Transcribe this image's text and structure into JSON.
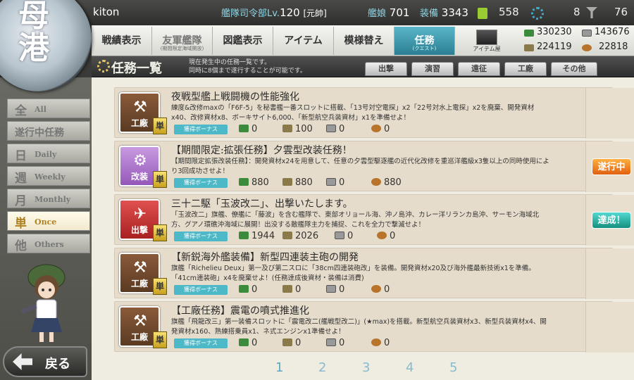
{
  "header": {
    "player": "kiton",
    "hq_label": "艦隊司令部Lv.",
    "hq_level": "120",
    "rank": "[元帥]",
    "ships_label": "艦娘",
    "ships": "701",
    "equip_label": "装備",
    "equip": "3343",
    "bucket": "558",
    "dev_mat": "8",
    "screw": "76"
  },
  "logo_text": "母港",
  "nav": {
    "items": [
      {
        "label": "戦績表示"
      },
      {
        "label": "友軍艦隊",
        "sub": "(期間限定海域開放)"
      },
      {
        "label": "図鑑表示"
      },
      {
        "label": "アイテム"
      },
      {
        "label": "模様替え"
      },
      {
        "label": "任務",
        "sub": "(クエスト)"
      }
    ],
    "shop_label": "アイテム屋"
  },
  "resources": {
    "fuel": "330230",
    "steel": "143676",
    "ammo": "224119",
    "bauxite": "22818"
  },
  "page_title": "任務一覧",
  "note_line1": "現在発生中の任務一覧です。",
  "note_line2": "同時に8個まで遂行することが可能です。",
  "cat_tabs": [
    "出撃",
    "演習",
    "遠征",
    "工廠",
    "その他"
  ],
  "categories": [
    {
      "jp": "全",
      "en": "All"
    },
    {
      "jp": "遂行中任務",
      "en": ""
    },
    {
      "jp": "日",
      "en": "Daily"
    },
    {
      "jp": "週",
      "en": "Weekly"
    },
    {
      "jp": "月",
      "en": "Monthly"
    },
    {
      "jp": "単",
      "en": "Once"
    },
    {
      "jp": "他",
      "en": "Others"
    }
  ],
  "active_category": "Once",
  "back_label": "戻る",
  "bonus_label": "獲得ボーナス",
  "once_mark": "単",
  "quests": [
    {
      "icon": "工廠",
      "title": "夜戦型艦上戦闘機の性能強化",
      "desc": "練度&改修maxの「F6F-5」を秘書艦一番スロットに搭載、「13号対空電探」x2「22号対水上電探」x2を廃棄、開発資材x40、改修資材x8、ボーキサイト6,000、「新型航空兵装資材」x1を準備せよ！",
      "fuel": "0",
      "ammo": "100",
      "steel": "0",
      "bauxite": "0",
      "status": ""
    },
    {
      "icon": "改装",
      "title": "【期間限定:拡張任務】夕雲型改装任務！",
      "desc": "【期間限定拡張改装任務】：開発資材x24を用意して、任意の夕雲型駆逐艦の近代化改修を重巡洋艦級x3隻以上の同時使用により3回成功させよ！",
      "fuel": "880",
      "ammo": "880",
      "steel": "0",
      "bauxite": "880",
      "status": "遂行中"
    },
    {
      "icon": "出撃",
      "title": "三十二駆「玉波改二」、出撃いたします。",
      "desc": "「玉波改二」旗艦、僚艦に「藤波」を含む艦隊で、東部オリョール海、沖ノ島沖、カレー洋リランカ島沖、サーモン海域北方、グアノ環礁沖海域に展開！出没する敵艦隊主力を捕捉、これを全力で撃滅せよ！",
      "fuel": "1944",
      "ammo": "2026",
      "steel": "0",
      "bauxite": "0",
      "status": "達成！"
    },
    {
      "icon": "工廠",
      "title": "【新鋭海外艦装備】新型四連装主砲の開発",
      "desc": "旗艦「Richelieu Deux」第一及び第二スロに「38cm四連装砲改」を装備。開発資材x20及び海外艦最新技術x1を準備。「41cm連装砲」x4を廃棄せよ！(任務達成後資材・装備は消費)",
      "fuel": "0",
      "ammo": "0",
      "steel": "0",
      "bauxite": "0",
      "status": ""
    },
    {
      "icon": "工廠",
      "title": "【工廠任務】震電の噴式推進化",
      "desc": "旗艦「飛龍改三」第一装備スロットに「震電改二(艦戦型改二)」(★max)を搭載。新型航空兵装資材x3、新型兵装資材x4、開発資材x160、熟練搭乗員x1、ネ式エンジンx1準備せよ！",
      "fuel": "0",
      "ammo": "0",
      "steel": "0",
      "bauxite": "0",
      "status": ""
    }
  ],
  "pages": [
    "1",
    "2",
    "3",
    "4",
    "5"
  ],
  "current_page": "1"
}
